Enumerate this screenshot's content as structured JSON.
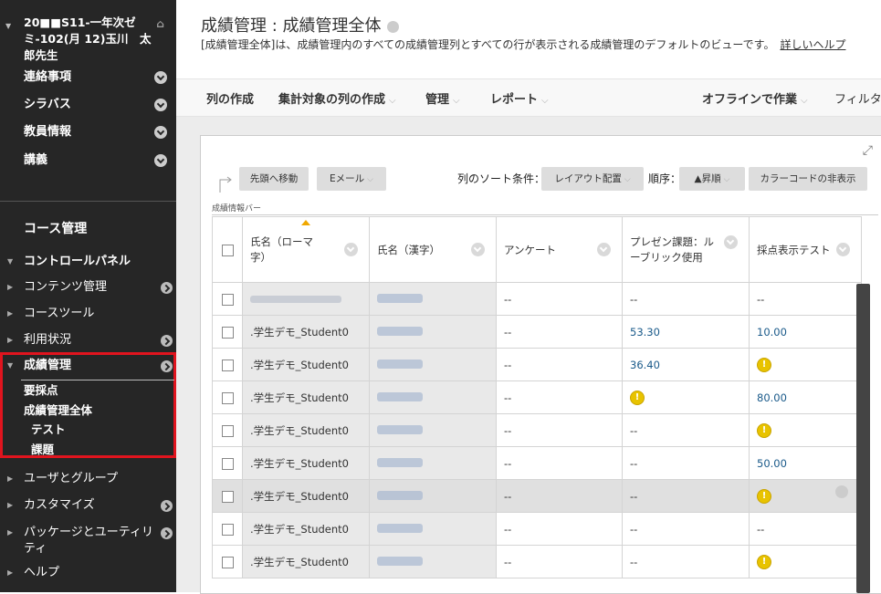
{
  "sidebar": {
    "course_title": "20■■S11-一年次ゼミ-102(月 12)玉川　太郎先生",
    "top_items": [
      "連絡事項",
      "シラバス",
      "教員情報",
      "講義"
    ],
    "course_mgmt_label": "コース管理",
    "control_panel_label": "コントロールパネル",
    "cp_items": [
      "コンテンツ管理",
      "コースツール",
      "利用状況"
    ],
    "grade_center_label": "成績管理",
    "grade_sub": [
      "要採点",
      "成績管理全体",
      "テスト",
      "課題"
    ],
    "bottom_items": [
      "ユーザとグループ",
      "カスタマイズ",
      "パッケージとユーティリティ",
      "ヘルプ"
    ]
  },
  "main": {
    "title": "成績管理 : 成績管理全体",
    "description": "[成績管理全体]は、成績管理内のすべての成績管理列とすべての行が表示される成績管理のデフォルトのビューです。",
    "help_link": "詳しいヘルプ",
    "action_bar": {
      "create_column": "列の作成",
      "create_calculated": "集計対象の列の作成",
      "manage": "管理",
      "reports": "レポート",
      "work_offline": "オフラインで作業",
      "filter": "フィルタ"
    },
    "grid_toolbar": {
      "move_to_top": "先頭へ移動",
      "email": "Eメール",
      "sort_label": "列のソート条件：",
      "sort_value": "レイアウト配置",
      "order_label": "順序：",
      "order_value": "▲昇順",
      "hide_color_codes": "カラーコードの非表示",
      "info_bar": "成績情報バー"
    },
    "columns": [
      "氏名（ローマ字）",
      "氏名（漢字）",
      "アンケート",
      "プレゼン課題：ルーブリック使用",
      "採点表示テスト"
    ],
    "rows": [
      {
        "name": "",
        "survey": "--",
        "presen": "--",
        "test": "--"
      },
      {
        "name": ".学生デモ_Student0",
        "survey": "--",
        "presen": "53.30",
        "test": "10.00"
      },
      {
        "name": ".学生デモ_Student0",
        "survey": "--",
        "presen": "36.40",
        "test": "!"
      },
      {
        "name": ".学生デモ_Student0",
        "survey": "--",
        "presen": "!",
        "test": "80.00"
      },
      {
        "name": ".学生デモ_Student0",
        "survey": "--",
        "presen": "--",
        "test": "!"
      },
      {
        "name": ".学生デモ_Student0",
        "survey": "--",
        "presen": "--",
        "test": "50.00"
      },
      {
        "name": ".学生デモ_Student0",
        "survey": "--",
        "presen": "--",
        "test": "!"
      },
      {
        "name": ".学生デモ_Student0",
        "survey": "--",
        "presen": "--",
        "test": "--"
      },
      {
        "name": ".学生デモ_Student0",
        "survey": "--",
        "presen": "--",
        "test": "!"
      }
    ]
  },
  "colors": {
    "sidebar_bg": "#262626",
    "highlight_red": "#e0141e",
    "grade_link": "#1a5a8a",
    "needs_grading": "#e8c300"
  }
}
